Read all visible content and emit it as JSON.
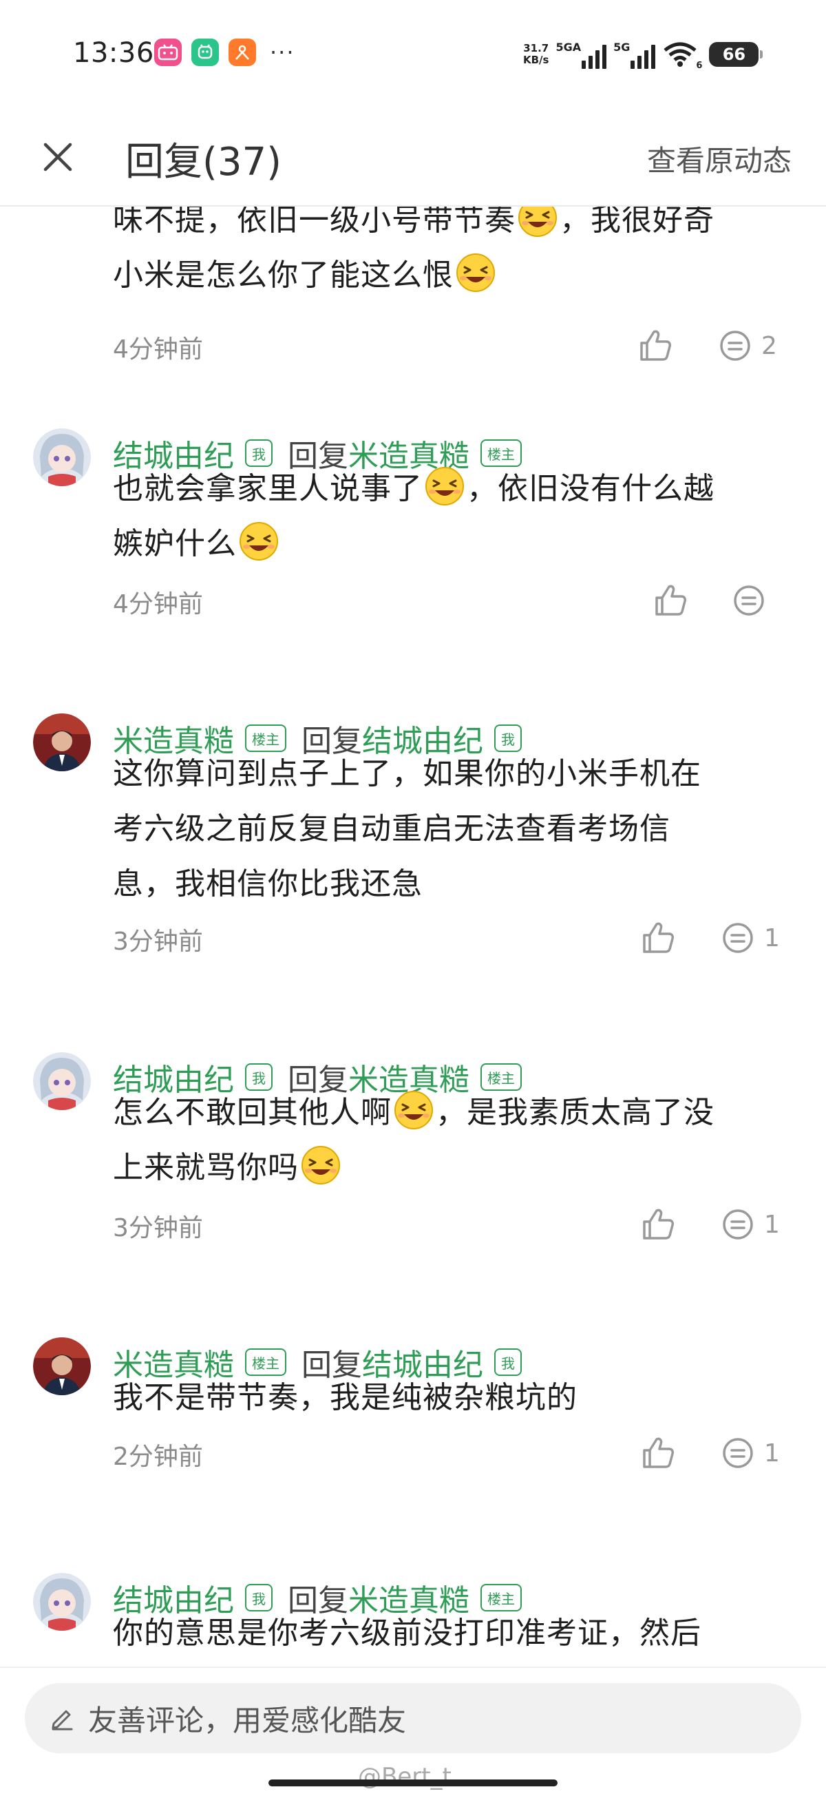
{
  "status_bar": {
    "time": "13:36",
    "more": "···",
    "speed_value": "31.7",
    "speed_unit": "KB/s",
    "net1": "5GA",
    "net2": "5G",
    "wifi_badge": "6",
    "battery": "66"
  },
  "header": {
    "title": "回复(37)",
    "view_original": "查看原动态"
  },
  "replies": [
    {
      "content_html_parts": [
        "味不提，依旧一级小号带节奏",
        "，我很好奇小米是怎么你了能这么恨",
        ""
      ],
      "line1": "味不提，依旧一级小号带节奏",
      "line1b": "，我很好奇",
      "line2": "小米是怎么你了能这么恨",
      "time": "4分钟前",
      "comment_count": "2"
    },
    {
      "name": "结城由纪",
      "name_tag": "我",
      "reply_word": "回复",
      "reply_to": "米造真糙",
      "reply_to_tag": "楼主",
      "line1": "也就会拿家里人说事了",
      "line1b": "，依旧没有什么越",
      "line2": "嫉妒什么",
      "time": "4分钟前",
      "comment_count": ""
    },
    {
      "name": "米造真糙",
      "name_tag": "楼主",
      "reply_word": "回复",
      "reply_to": "结城由纪",
      "reply_to_tag": "我",
      "line1": "这你算问到点子上了，如果你的小米手机在",
      "line2": "考六级之前反复自动重启无法查看考场信",
      "line3": "息，我相信你比我还急",
      "time": "3分钟前",
      "comment_count": "1"
    },
    {
      "name": "结城由纪",
      "name_tag": "我",
      "reply_word": "回复",
      "reply_to": "米造真糙",
      "reply_to_tag": "楼主",
      "line1": "怎么不敢回其他人啊",
      "line1b": "，是我素质太高了没",
      "line2": "上来就骂你吗",
      "time": "3分钟前",
      "comment_count": "1"
    },
    {
      "name": "米造真糙",
      "name_tag": "楼主",
      "reply_word": "回复",
      "reply_to": "结城由纪",
      "reply_to_tag": "我",
      "line1": "我不是带节奏，我是纯被杂粮坑的",
      "time": "2分钟前",
      "comment_count": "1"
    },
    {
      "name": "结城由纪",
      "name_tag": "我",
      "reply_word": "回复",
      "reply_to": "米造真糙",
      "reply_to_tag": "楼主",
      "line1": "你的意思是你考六级前没打印准考证，然后"
    }
  ],
  "input": {
    "placeholder": "友善评论，用爱感化酷友"
  },
  "watermark": "@Bert_t",
  "colors": {
    "accent_green": "#2f9d55",
    "meta_gray": "#8a8a8a"
  },
  "icons": [
    "close-icon",
    "like-icon",
    "comment-icon",
    "emoji-laugh-icon",
    "edit-icon"
  ]
}
